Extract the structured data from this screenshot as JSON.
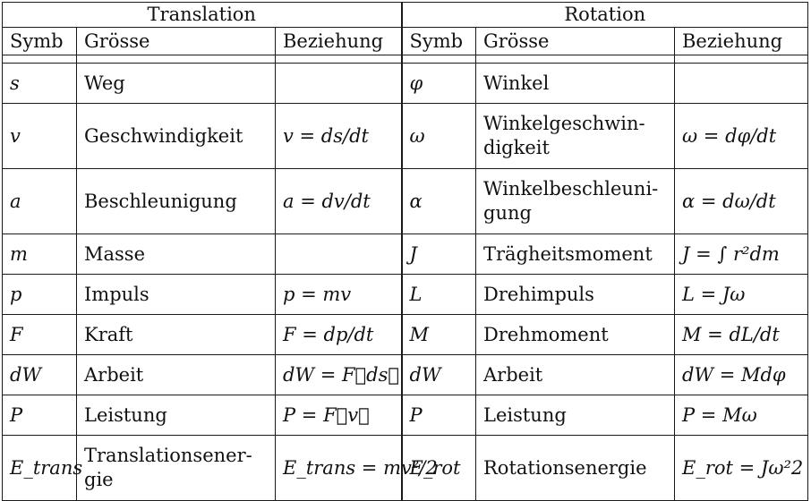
{
  "header": {
    "translation": "Translation",
    "rotation": "Rotation"
  },
  "columns": {
    "symb": "Symb",
    "groesse": "Grösse",
    "beziehung": "Beziehung"
  },
  "rows": [
    {
      "t_sym": "s",
      "t_name": "Weg",
      "t_rel": "",
      "r_sym": "φ",
      "r_name": "Winkel",
      "r_rel": ""
    },
    {
      "t_sym": "v",
      "t_name": "Geschwindigkeit",
      "t_rel": "v = ds/dt",
      "r_sym": "ω",
      "r_name": "Winkelgeschwin-digkeit",
      "r_rel": "ω = dφ/dt"
    },
    {
      "t_sym": "a",
      "t_name": "Beschleunigung",
      "t_rel": "a = dv/dt",
      "r_sym": "α",
      "r_name": "Winkelbeschleuni-gung",
      "r_rel": "α = dω/dt"
    },
    {
      "t_sym": "m",
      "t_name": "Masse",
      "t_rel": "",
      "r_sym": "J",
      "r_name": "Trägheitsmoment",
      "r_rel": "J = ∫ r²dm"
    },
    {
      "t_sym": "p",
      "t_name": "Impuls",
      "t_rel": "p = mv",
      "r_sym": "L",
      "r_name": "Drehimpuls",
      "r_rel": "L = Jω"
    },
    {
      "t_sym": "F",
      "t_name": "Kraft",
      "t_rel": "F = dp/dt",
      "r_sym": "M",
      "r_name": "Drehmoment",
      "r_rel": "M = dL/dt"
    },
    {
      "t_sym": "dW",
      "t_name": "Arbeit",
      "t_rel": "dW = F⃗ds⃗",
      "r_sym": "dW",
      "r_name": "Arbeit",
      "r_rel": "dW = Mdφ"
    },
    {
      "t_sym": "P",
      "t_name": "Leistung",
      "t_rel": "P = F⃗v⃗",
      "r_sym": "P",
      "r_name": "Leistung",
      "r_rel": "P = Mω"
    },
    {
      "t_sym": "E_trans",
      "t_name": "Translationsener-gie",
      "t_rel": "E_trans = mv²/2",
      "r_sym": "E_rot",
      "r_name": "Rotationsenergie",
      "r_rel": "E_rot = Jω²2"
    }
  ]
}
